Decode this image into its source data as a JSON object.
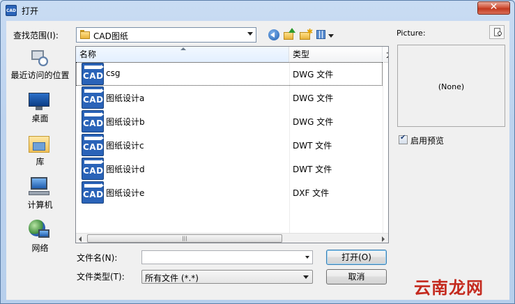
{
  "window": {
    "icon_text": "CAD",
    "title": "打开",
    "close_symbol": "✕"
  },
  "lookin": {
    "label": "查找范围(I):",
    "value": "CAD图纸"
  },
  "places": [
    {
      "label": "最近访问的位置",
      "icon": "recent-places-icon"
    },
    {
      "label": "桌面",
      "icon": "desktop-icon"
    },
    {
      "label": "库",
      "icon": "libraries-icon"
    },
    {
      "label": "计算机",
      "icon": "computer-icon"
    },
    {
      "label": "网络",
      "icon": "network-icon"
    }
  ],
  "filelist": {
    "columns": [
      "名称",
      "类型",
      "大"
    ],
    "files": [
      {
        "name": "csg",
        "type": "DWG 文件",
        "icon_text": "CAD"
      },
      {
        "name": "图纸设计a",
        "type": "DWG 文件",
        "icon_text": "CAD"
      },
      {
        "name": "图纸设计b",
        "type": "DWG 文件",
        "icon_text": "CAD"
      },
      {
        "name": "图纸设计c",
        "type": "DWT 文件",
        "icon_text": "CAD"
      },
      {
        "name": "图纸设计d",
        "type": "DWT 文件",
        "icon_text": "CAD"
      },
      {
        "name": "图纸设计e",
        "type": "DXF 文件",
        "icon_text": "CAD"
      }
    ],
    "scroll_grip": "|||"
  },
  "preview": {
    "label": "Picture:",
    "empty_text": "(None)",
    "checkbox_label": "启用预览",
    "checkbox_checked": true
  },
  "filename": {
    "label": "文件名(N):",
    "value": ""
  },
  "filetype": {
    "label": "文件类型(T):",
    "value": "所有文件 (*.*)"
  },
  "buttons": {
    "open": "打开(O)",
    "cancel": "取消"
  },
  "watermark": "云南龙网"
}
